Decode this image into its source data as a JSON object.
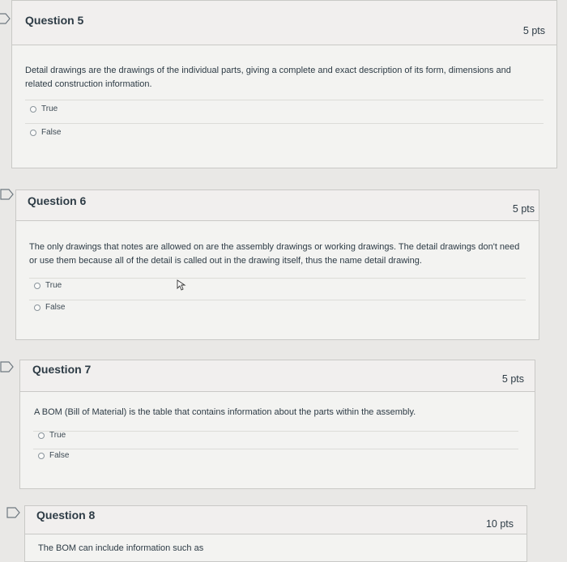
{
  "questions": [
    {
      "title": "Question 5",
      "points": "5 pts",
      "text": "Detail drawings are the drawings of the individual parts, giving a complete and exact description of its form, dimensions and related construction information.",
      "options": [
        "True",
        "False"
      ]
    },
    {
      "title": "Question 6",
      "points": "5 pts",
      "text": "The only drawings that notes are allowed on are the assembly drawings or working drawings. The detail drawings don't need or use them because all of the detail is called out in the drawing itself, thus the name detail drawing.",
      "options": [
        "True",
        "False"
      ]
    },
    {
      "title": "Question 7",
      "points": "5 pts",
      "text": "A BOM (Bill of Material) is the table that contains information about the parts within the assembly.",
      "options": [
        "True",
        "False"
      ]
    },
    {
      "title": "Question 8",
      "points": "10 pts",
      "text": "The BOM can include information such as"
    }
  ],
  "colors": {
    "background": "#e9e8e6",
    "card": "#f3f3f1",
    "header": "#f1efee",
    "border": "#c9c9c6",
    "text": "#2d3b45"
  },
  "icons": {
    "flag": "flag-icon",
    "radio": "radio-button-icon",
    "cursor": "mouse-pointer-icon"
  }
}
